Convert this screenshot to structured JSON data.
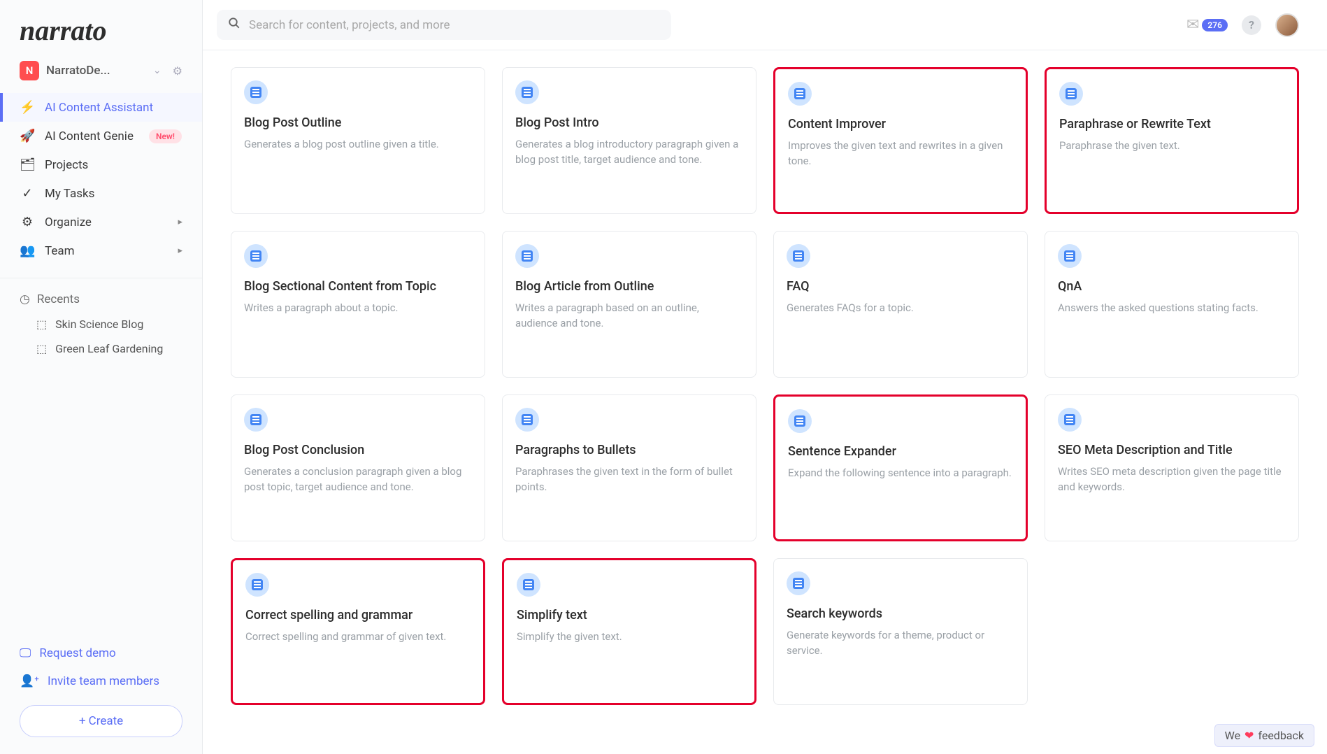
{
  "brand": "narrato",
  "workspace": {
    "initial": "N",
    "name": "NarratoDe..."
  },
  "search": {
    "placeholder": "Search for content, projects, and more"
  },
  "notifications": {
    "count": "276"
  },
  "nav": [
    {
      "icon": "⚡",
      "label": "AI Content Assistant",
      "active": true
    },
    {
      "icon": "🚀",
      "label": "AI Content Genie",
      "badge": "New!"
    },
    {
      "icon": "🗂",
      "label": "Projects"
    },
    {
      "icon": "✓",
      "label": "My Tasks"
    },
    {
      "icon": "⚙",
      "label": "Organize",
      "expand": true
    },
    {
      "icon": "👥",
      "label": "Team",
      "expand": true
    }
  ],
  "recents": {
    "header": "Recents",
    "items": [
      "Skin Science Blog",
      "Green Leaf Gardening"
    ]
  },
  "footer": {
    "demo": "Request demo",
    "invite": "Invite team members",
    "create": "+ Create"
  },
  "cards": [
    {
      "title": "Blog Post Outline",
      "desc": "Generates a blog post outline given a title.",
      "hl": false
    },
    {
      "title": "Blog Post Intro",
      "desc": "Generates a blog introductory paragraph given a blog post title, target audience and tone.",
      "hl": false
    },
    {
      "title": "Content Improver",
      "desc": "Improves the given text and rewrites in a given tone.",
      "hl": true
    },
    {
      "title": "Paraphrase or Rewrite Text",
      "desc": "Paraphrase the given text.",
      "hl": true
    },
    {
      "title": "Blog Sectional Content from Topic",
      "desc": "Writes a paragraph about a topic.",
      "hl": false
    },
    {
      "title": "Blog Article from Outline",
      "desc": "Writes a paragraph based on an outline, audience and tone.",
      "hl": false
    },
    {
      "title": "FAQ",
      "desc": "Generates FAQs for a topic.",
      "hl": false
    },
    {
      "title": "QnA",
      "desc": "Answers the asked questions stating facts.",
      "hl": false
    },
    {
      "title": "Blog Post Conclusion",
      "desc": "Generates a conclusion paragraph given a blog post topic, target audience and tone.",
      "hl": false
    },
    {
      "title": "Paragraphs to Bullets",
      "desc": "Paraphrases the given text in the form of bullet points.",
      "hl": false
    },
    {
      "title": "Sentence Expander",
      "desc": "Expand the following sentence into a paragraph.",
      "hl": true
    },
    {
      "title": "SEO Meta Description and Title",
      "desc": "Writes SEO meta description given the page title and keywords.",
      "hl": false
    },
    {
      "title": "Correct spelling and grammar",
      "desc": "Correct spelling and grammar of given text.",
      "hl": true
    },
    {
      "title": "Simplify text",
      "desc": "Simplify the given text.",
      "hl": true
    },
    {
      "title": "Search keywords",
      "desc": "Generate keywords for a theme, product or service.",
      "hl": false
    }
  ],
  "feedback": {
    "prefix": "We",
    "suffix": "feedback"
  }
}
